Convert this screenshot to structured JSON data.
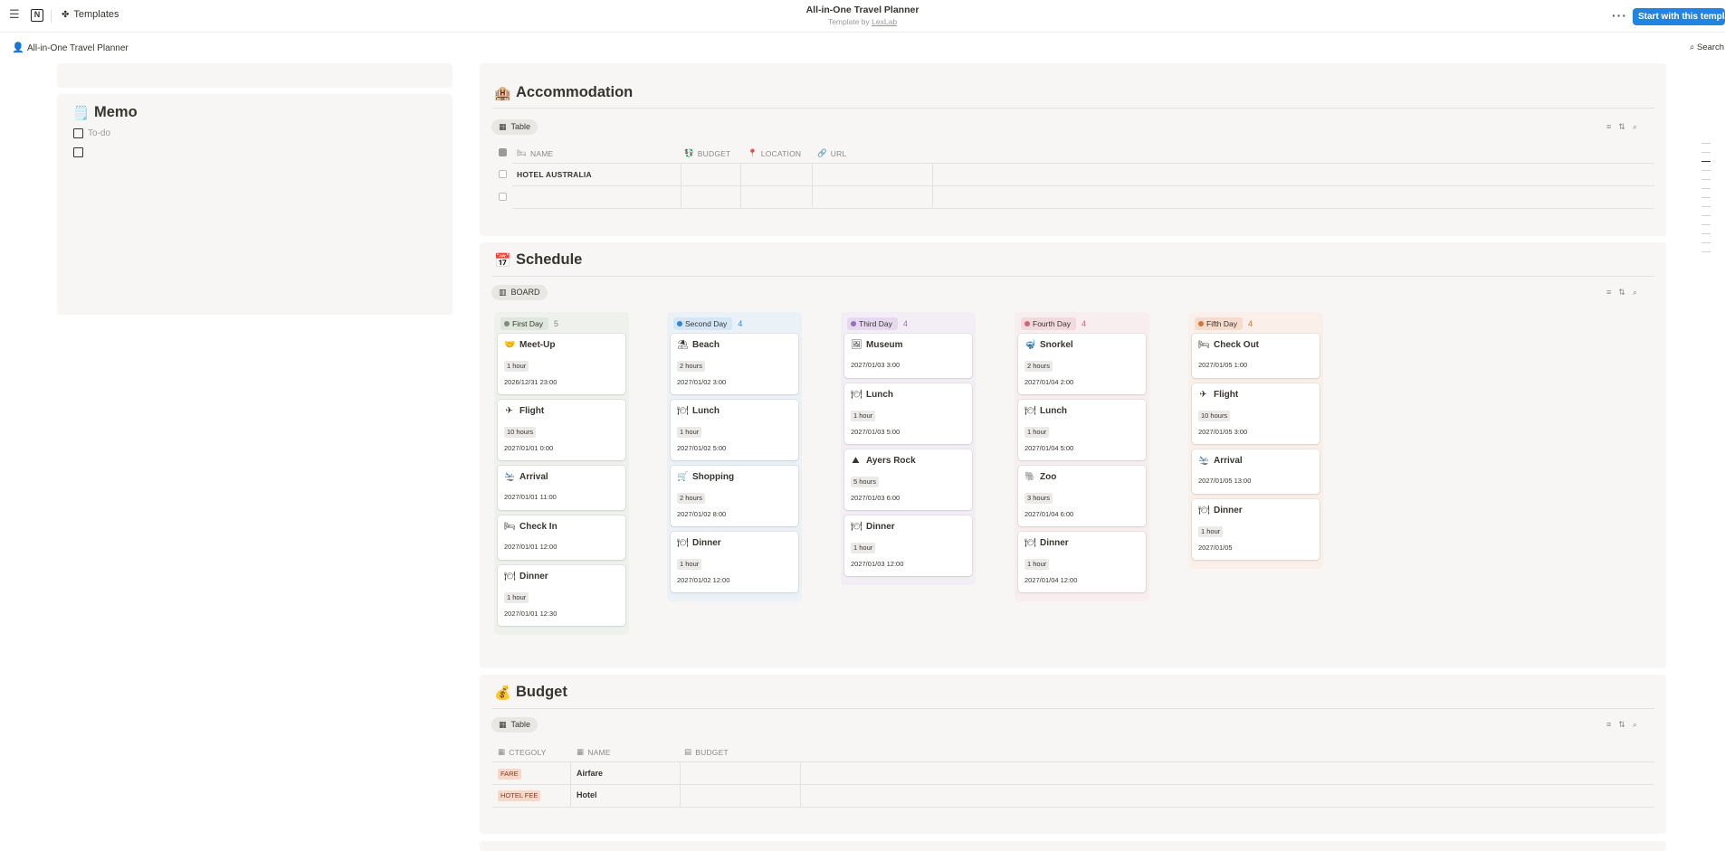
{
  "topbar": {
    "templates_label": "Templates",
    "title": "All-in-One Travel Planner",
    "subtitle_prefix": "Template by ",
    "subtitle_author": "LexLab",
    "start_button": "Start with this template"
  },
  "subbar": {
    "page_name": "All-in-One Travel Planner",
    "search_label": "Search"
  },
  "memo": {
    "title": "Memo",
    "emoji": "🗒️",
    "todo_placeholder": "To-do"
  },
  "accommodation": {
    "title": "Accommodation",
    "emoji": "🏨",
    "view_label": "Table",
    "columns": [
      "NAME",
      "BUDGET",
      "LOCATION",
      "URL"
    ],
    "rows": [
      {
        "name": "HOTEL AUSTRALIA"
      }
    ]
  },
  "schedule": {
    "title": "Schedule",
    "emoji": "📅",
    "view_label": "BOARD",
    "columns": [
      {
        "label": "First Day",
        "count": "5",
        "color": "#7a8f74",
        "bg": "#eef1ec",
        "tagbg": "#dfe6db",
        "cards": [
          {
            "icon": "🤝",
            "title": "Meet-Up",
            "duration": "1 hour",
            "date": "2026/12/31 23:00"
          },
          {
            "icon": "✈",
            "title": "Flight",
            "duration": "10 hours",
            "date": "2027/01/01 0:00"
          },
          {
            "icon": "🛬",
            "title": "Arrival",
            "duration": "",
            "date": "2027/01/01 11:00"
          },
          {
            "icon": "🛏",
            "title": "Check In",
            "duration": "",
            "date": "2027/01/01 12:00"
          },
          {
            "icon": "🍽",
            "title": "Dinner",
            "duration": "1 hour",
            "date": "2027/01/01 12:30"
          }
        ]
      },
      {
        "label": "Second Day",
        "count": "4",
        "color": "#2f86d6",
        "bg": "#eaf2f8",
        "tagbg": "#d5e7f6",
        "cards": [
          {
            "icon": "⛱",
            "title": "Beach",
            "duration": "2 hours",
            "date": "2027/01/02 3:00"
          },
          {
            "icon": "🍽",
            "title": "Lunch",
            "duration": "1 hour",
            "date": "2027/01/02 5:00"
          },
          {
            "icon": "🛒",
            "title": "Shopping",
            "duration": "2 hours",
            "date": "2027/01/02 8:00"
          },
          {
            "icon": "🍽",
            "title": "Dinner",
            "duration": "1 hour",
            "date": "2027/01/02 12:00"
          }
        ]
      },
      {
        "label": "Third Day",
        "count": "4",
        "color": "#9a6dc4",
        "bg": "#f3eef6",
        "tagbg": "#e6d9ef",
        "cards": [
          {
            "icon": "🖼",
            "title": "Museum",
            "duration": "",
            "date": "2027/01/03 3:00"
          },
          {
            "icon": "🍽",
            "title": "Lunch",
            "duration": "1 hour",
            "date": "2027/01/03 5:00"
          },
          {
            "icon": "⛰",
            "title": "Ayers Rock",
            "duration": "5 hours",
            "date": "2027/01/03 6:00"
          },
          {
            "icon": "🍽",
            "title": "Dinner",
            "duration": "1 hour",
            "date": "2027/01/03 12:00"
          }
        ]
      },
      {
        "label": "Fourth Day",
        "count": "4",
        "color": "#d0667a",
        "bg": "#f8eef0",
        "tagbg": "#f1d9de",
        "cards": [
          {
            "icon": "🤿",
            "title": "Snorkel",
            "duration": "2 hours",
            "date": "2027/01/04 2:00"
          },
          {
            "icon": "🍽",
            "title": "Lunch",
            "duration": "1 hour",
            "date": "2027/01/04 5:00"
          },
          {
            "icon": "🐘",
            "title": "Zoo",
            "duration": "3 hours",
            "date": "2027/01/04 6:00"
          },
          {
            "icon": "🍽",
            "title": "Dinner",
            "duration": "1 hour",
            "date": "2027/01/04 12:00"
          }
        ]
      },
      {
        "label": "Fifth Day",
        "count": "4",
        "color": "#d9733a",
        "bg": "#faefe9",
        "tagbg": "#f5dccd",
        "cards": [
          {
            "icon": "🛏",
            "title": "Check Out",
            "duration": "",
            "date": "2027/01/05 1:00"
          },
          {
            "icon": "✈",
            "title": "Flight",
            "duration": "10 hours",
            "date": "2027/01/05 3:00"
          },
          {
            "icon": "🛬",
            "title": "Arrival",
            "duration": "",
            "date": "2027/01/05 13:00"
          },
          {
            "icon": "🍽",
            "title": "Dinner",
            "duration": "1 hour",
            "date": "2027/01/05"
          }
        ]
      }
    ]
  },
  "budget": {
    "title": "Budget",
    "emoji": "💰",
    "view_label": "Table",
    "columns": [
      "CTEGOLY",
      "NAME",
      "BUDGET"
    ],
    "rows": [
      {
        "category": "FARE",
        "name": "Airfare"
      },
      {
        "category": "HOTEL FEE",
        "name": "Hotel"
      }
    ]
  }
}
